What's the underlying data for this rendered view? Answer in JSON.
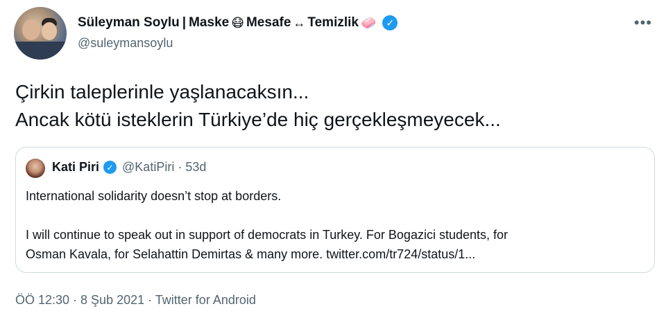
{
  "author": {
    "name": "Süleyman Soylu",
    "separator": "|",
    "tagline": [
      {
        "text": "Maske",
        "emoji": "😷"
      },
      {
        "text": "Mesafe",
        "emoji": "↔"
      },
      {
        "text": "Temizlik",
        "emoji": "🧼"
      }
    ],
    "handle": "@suleymansoylu",
    "verified": true
  },
  "tweet": {
    "lines": [
      "Çirkin taleplerinle yaşlanacaksın...",
      "Ancak kötü isteklerin Türkiye’de hiç gerçekleşmeyecek..."
    ]
  },
  "quoted": {
    "name": "Kati Piri",
    "handle": "@KatiPiri · 53d",
    "verified": true,
    "paragraphs": [
      "International solidarity doesn’t stop at borders.",
      "I will continue to speak out in support of democrats in Turkey. For Bogazici students, for",
      "Osman Kavala, for Selahattin Demirtas & many more. twitter.com/tr724/status/1..."
    ]
  },
  "footer": {
    "meta": "ÖÖ 12:30 · 8 Şub 2021 · Twitter for Android"
  },
  "icons": {
    "more": "more-icon",
    "verified": "verified-badge-icon"
  },
  "colors": {
    "accent": "#1d9bf0",
    "secondary_text": "#536471",
    "border": "#cfd9de"
  }
}
